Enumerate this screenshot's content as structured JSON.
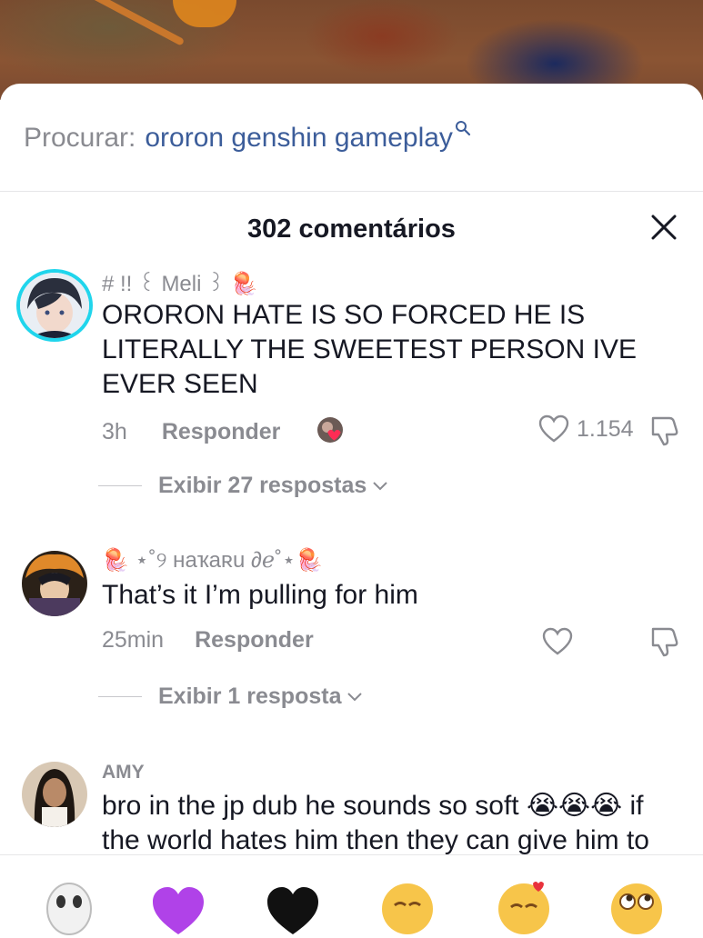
{
  "search": {
    "prefix": "Procurar:",
    "term": "ororon genshin gameplay"
  },
  "header": {
    "title": "302 comentários"
  },
  "comments": [
    {
      "username": "# !! ꒰ Meli ꒱ 🪼",
      "text": "ORORON HATE IS SO FORCED HE IS LITERALLY THE SWEETEST PERSON IVE EVER SEEN",
      "time": "3h",
      "reply_label": "Responder",
      "likes": "1.154",
      "view_replies": "Exibir 27 respostas",
      "creator_liked": true
    },
    {
      "username": "🪼 ⋆˚୨ ʜaҡaʀu ∂ℯ˚⋆🪼",
      "text": "That’s it I’m pulling for him",
      "time": "25min",
      "reply_label": "Responder",
      "view_replies": "Exibir 1 resposta"
    },
    {
      "username": "AMY",
      "text": "bro in the jp dub he sounds so soft 😭😭😭 if the world hates him then they can give him to",
      "time": "",
      "reply_label": ""
    }
  ],
  "emoji_bar": {
    "items": [
      "ghost-emoji",
      "purple-heart-emoji",
      "black-heart-emoji",
      "relieved-emoji",
      "hearts-face-emoji",
      "rolling-eyes-emoji"
    ]
  },
  "colors": {
    "accent_link": "#3c5d9a",
    "muted_text": "#8a8b91",
    "story_ring": "#20d5ec",
    "heart_badge": "#fe2c55"
  }
}
